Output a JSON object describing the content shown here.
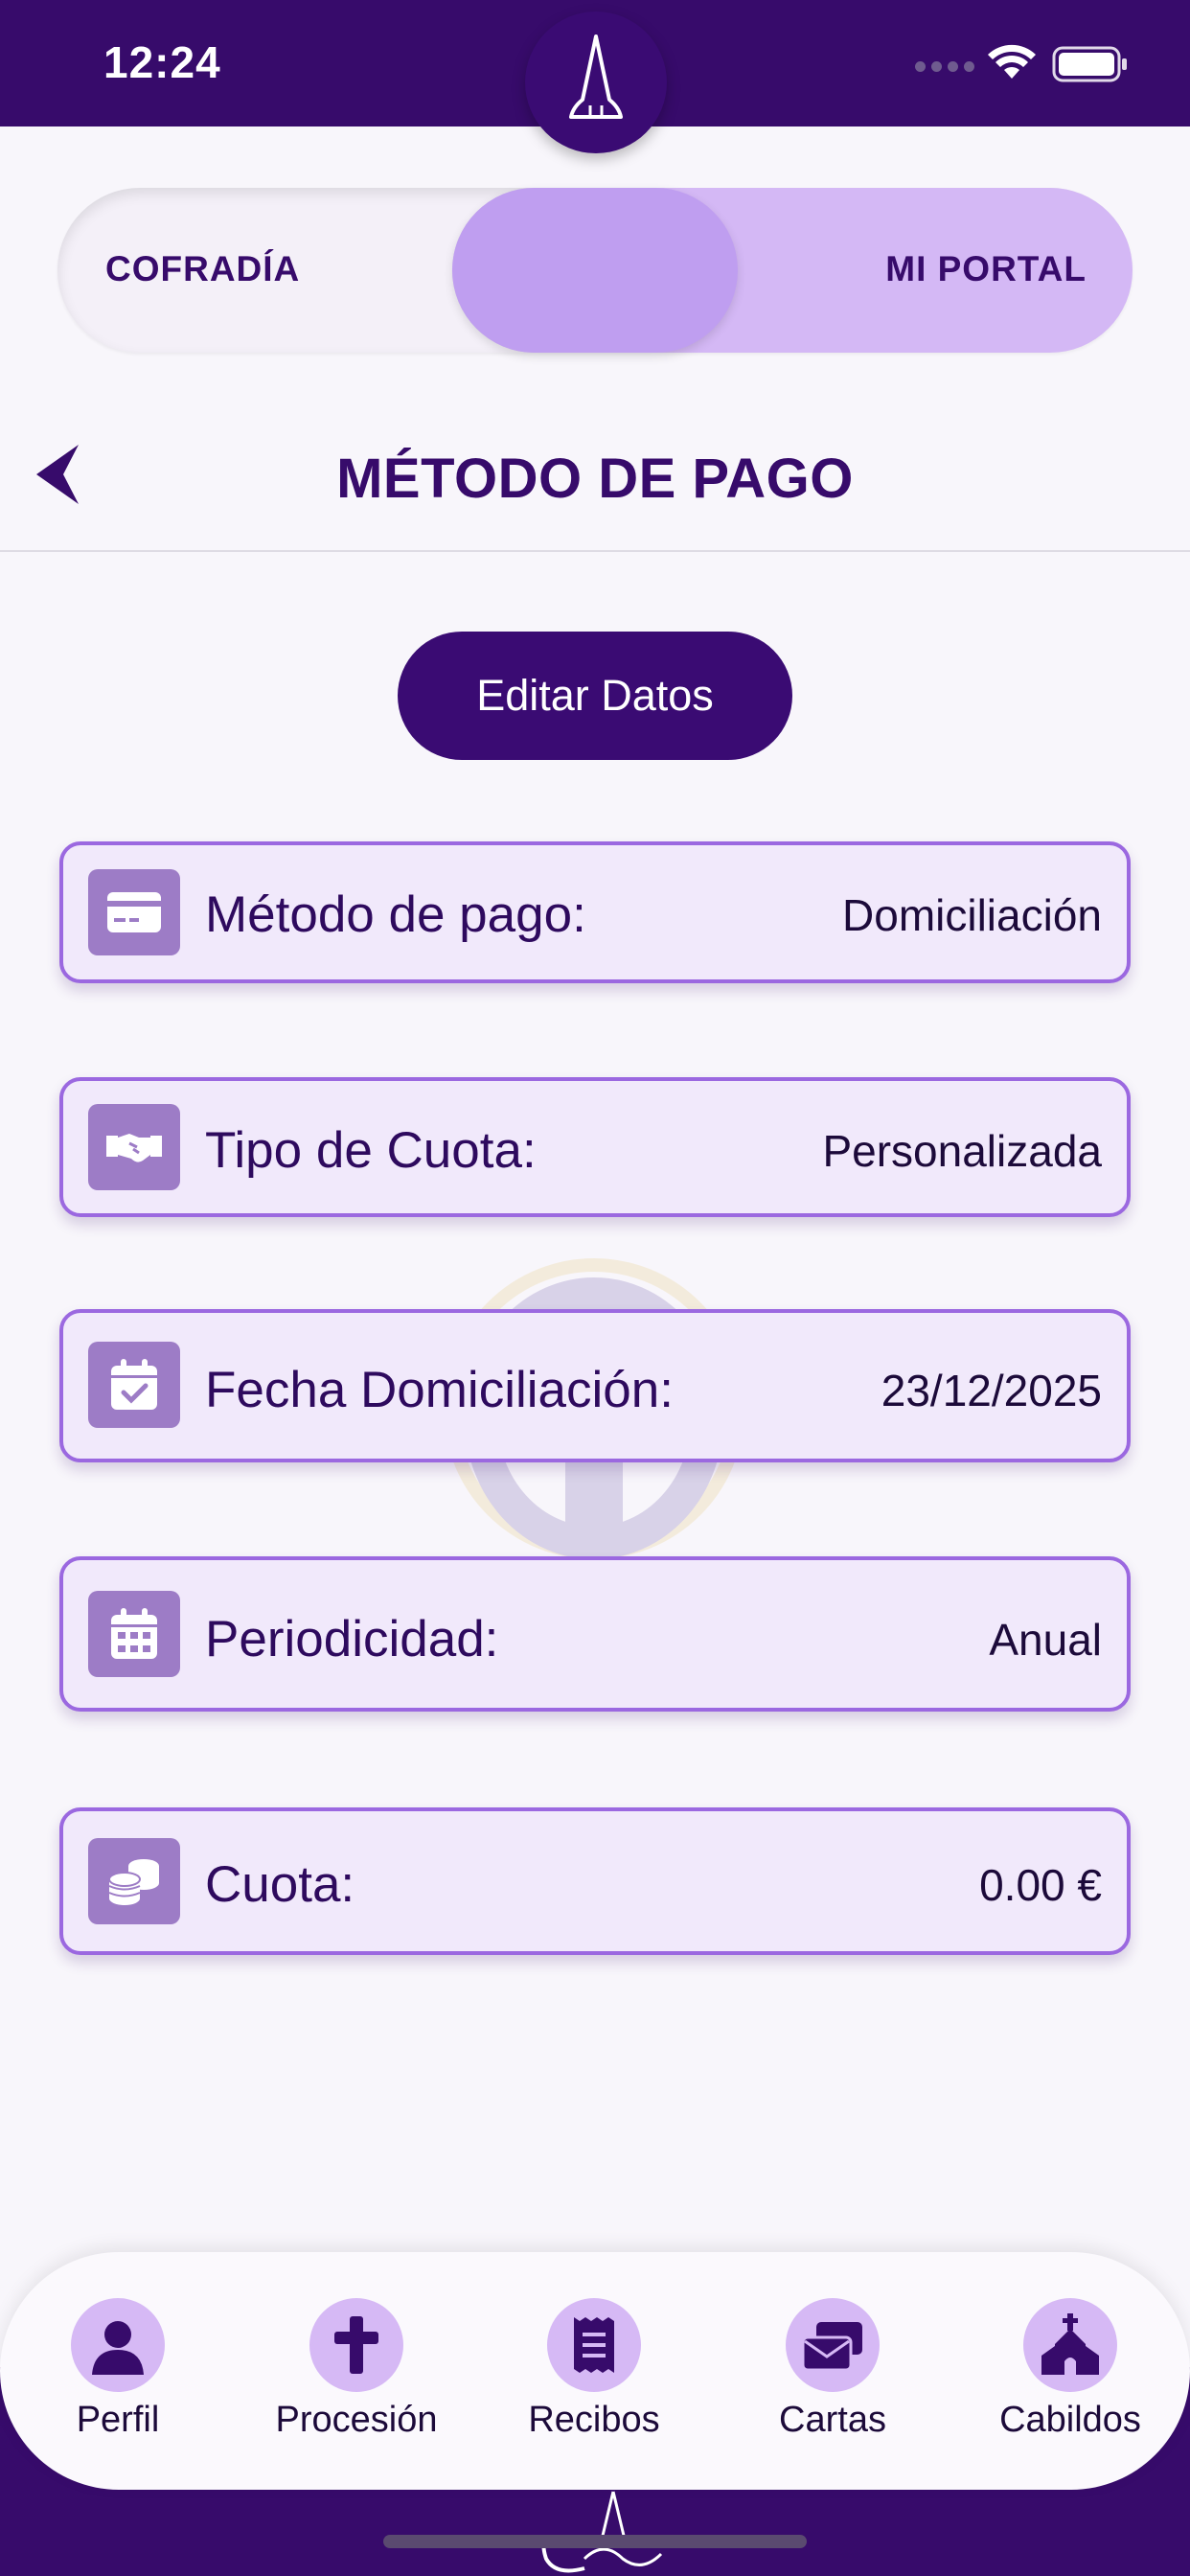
{
  "status_bar": {
    "time": "12:24"
  },
  "toggle": {
    "left_label": "COFRADÍA",
    "right_label": "MI PORTAL",
    "selected": "MI PORTAL"
  },
  "header": {
    "title": "MÉTODO DE PAGO"
  },
  "actions": {
    "edit_label": "Editar Datos"
  },
  "fields": [
    {
      "icon": "credit-card-icon",
      "label": "Método de pago:",
      "value": "Domiciliación"
    },
    {
      "icon": "handshake-icon",
      "label": "Tipo de Cuota:",
      "value": "Personalizada"
    },
    {
      "icon": "calendar-check-icon",
      "label": "Fecha Domiciliación:",
      "value": "23/12/2025"
    },
    {
      "icon": "calendar-icon",
      "label": "Periodicidad:",
      "value": "Anual"
    },
    {
      "icon": "coins-icon",
      "label": "Cuota:",
      "value": "0.00 €"
    }
  ],
  "bottom_nav": {
    "items": [
      {
        "icon": "user-icon",
        "label": "Perfil"
      },
      {
        "icon": "cross-icon",
        "label": "Procesión"
      },
      {
        "icon": "receipt-icon",
        "label": "Recibos"
      },
      {
        "icon": "letters-icon",
        "label": "Cartas"
      },
      {
        "icon": "chapel-icon",
        "label": "Cabildos"
      }
    ]
  },
  "colors": {
    "primary": "#370b6b",
    "accent_light": "#d4b8f5",
    "card_border": "#9b68e0",
    "card_background": "#f1e9fb",
    "icon_tile": "#9d7cc6",
    "page_background": "#f8f6fb"
  }
}
